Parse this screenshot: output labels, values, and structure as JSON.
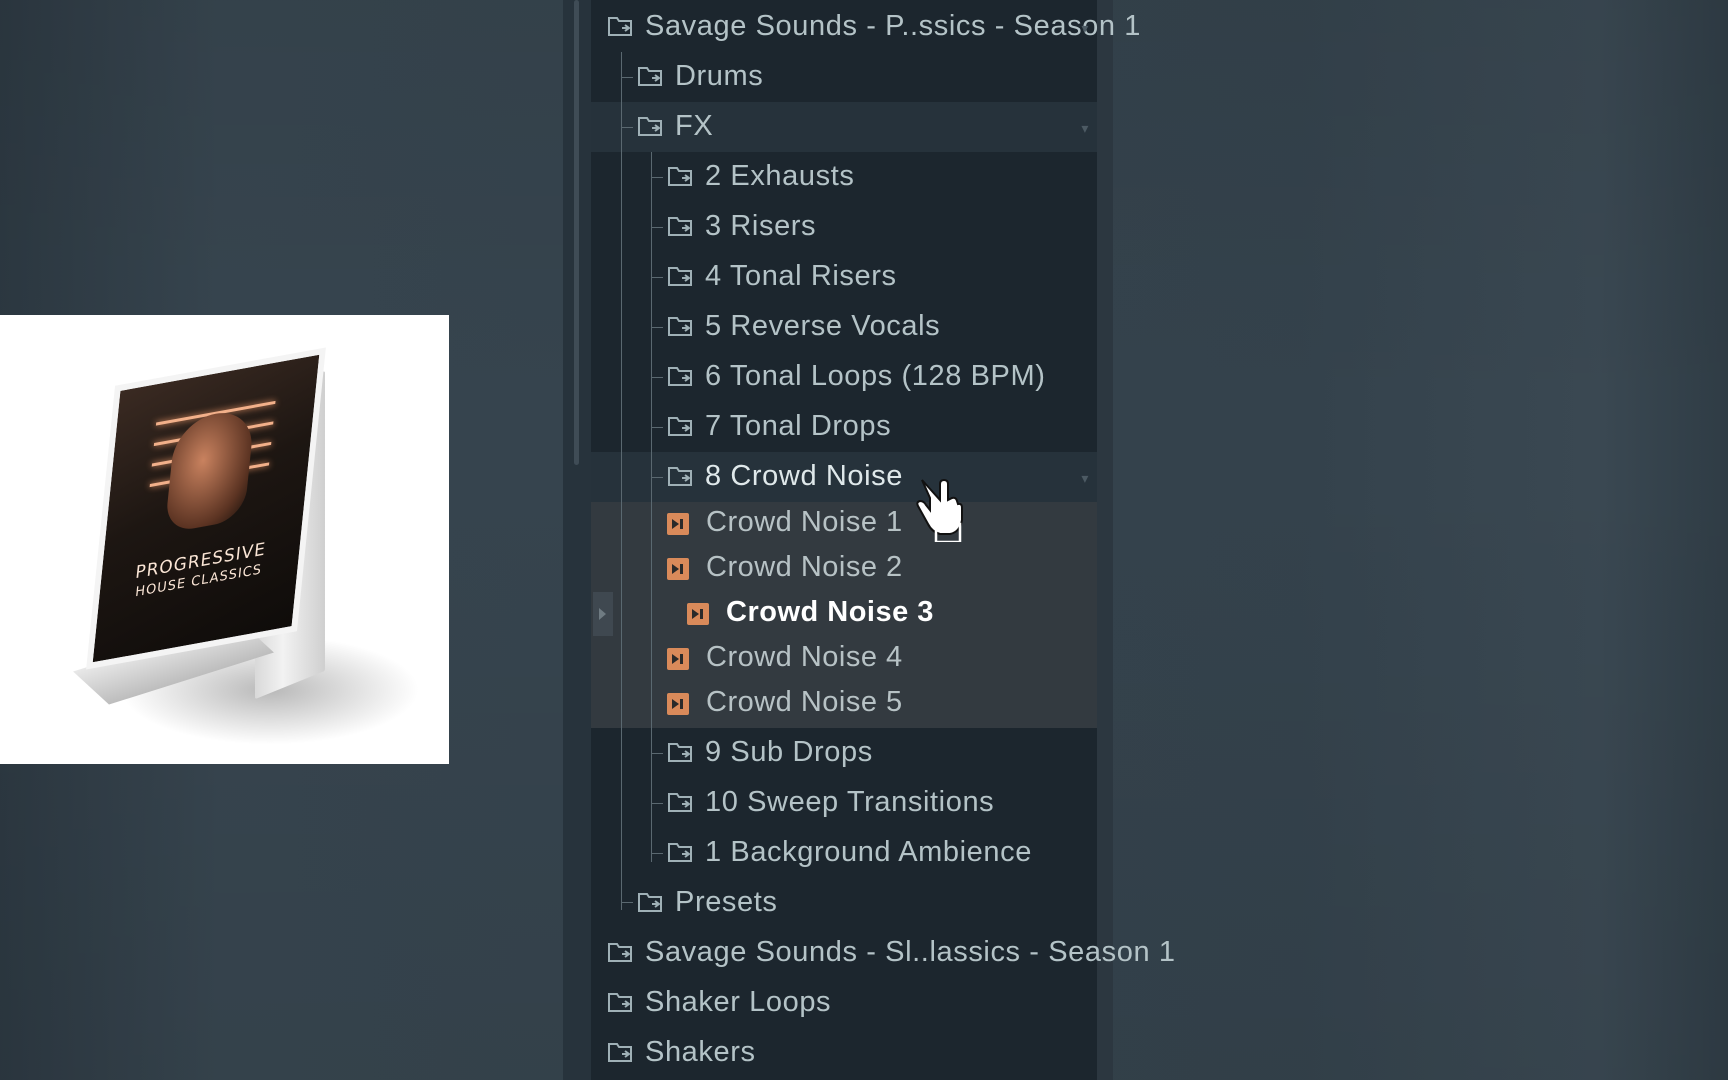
{
  "product_box": {
    "title": "PROGRESSIVE",
    "subtitle": "HOUSE CLASSICS"
  },
  "browser": {
    "folders_top": [
      {
        "label": "Savage Sounds - P..ssics - Season 1",
        "level": 0,
        "highlighted": false,
        "dropdown": true
      },
      {
        "label": "Drums",
        "level": 1,
        "highlighted": false,
        "dropdown": false
      },
      {
        "label": "FX",
        "level": 1,
        "highlighted": true,
        "dropdown": true
      },
      {
        "label": "2 Exhausts",
        "level": 2,
        "highlighted": false,
        "dropdown": false
      },
      {
        "label": "3 Risers",
        "level": 2,
        "highlighted": false,
        "dropdown": false
      },
      {
        "label": "4 Tonal Risers",
        "level": 2,
        "highlighted": false,
        "dropdown": false
      },
      {
        "label": "5 Reverse Vocals",
        "level": 2,
        "highlighted": false,
        "dropdown": false
      },
      {
        "label": "6 Tonal Loops (128 BPM)",
        "level": 2,
        "highlighted": false,
        "dropdown": false
      },
      {
        "label": "7 Tonal Drops",
        "level": 2,
        "highlighted": false,
        "dropdown": false
      },
      {
        "label": "8 Crowd Noise",
        "level": 2,
        "highlighted": true,
        "dropdown": true
      }
    ],
    "files": [
      {
        "label": "Crowd Noise 1",
        "selected": false
      },
      {
        "label": "Crowd Noise 2",
        "selected": false
      },
      {
        "label": "Crowd Noise 3",
        "selected": true
      },
      {
        "label": "Crowd Noise 4",
        "selected": false
      },
      {
        "label": "Crowd Noise 5",
        "selected": false
      }
    ],
    "folders_bottom": [
      {
        "label": "9 Sub Drops",
        "level": 2
      },
      {
        "label": "10 Sweep Transitions",
        "level": 2
      },
      {
        "label": "1 Background Ambience",
        "level": 2
      },
      {
        "label": "Presets",
        "level": 1
      },
      {
        "label": "Savage Sounds - Sl..lassics - Season 1",
        "level": 0
      },
      {
        "label": "Shaker Loops",
        "level": 0
      },
      {
        "label": "Shakers",
        "level": 0
      }
    ]
  },
  "colors": {
    "background": "#34424c",
    "panel": "#1c262e",
    "folder_text": "#b4c3c7",
    "audio_icon": "#d98a5a",
    "file_area": "#333a40"
  },
  "icons": {
    "folder": "folder-icon",
    "audio_file": "audio-file-icon",
    "cursor": "hand-cursor-icon",
    "dropdown": "dropdown-arrow-icon"
  }
}
